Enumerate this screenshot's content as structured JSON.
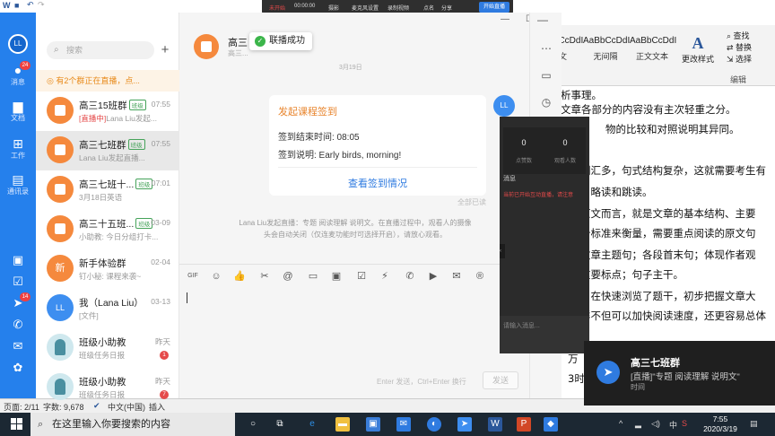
{
  "recorder_bar": {
    "items": [
      "未开始",
      "00:00:00",
      "摄影",
      "麦克风设置",
      "录制视频",
      "点名",
      "分享",
      "自定义选",
      "开始直播"
    ]
  },
  "word": {
    "styles": [
      {
        "sample": "AaBbCcDdI",
        "name": "正文"
      },
      {
        "sample": "AaBbCcDdI",
        "name": "无间隔"
      },
      {
        "sample": "AaBbCcDdI",
        "name": "正文文本"
      }
    ],
    "change_style": "更改样式",
    "edit_cmds": [
      "查找",
      "替换",
      "选择"
    ],
    "edit_label": "编辑",
    "doc_lines": [
      "析事理。",
      "文章各部分的内容没有主次轻重之分。",
      "物的比较和对照说明其异同。",
      "词汇多，句式结构复杂，这就需要考生有",
      "、略读和跳读。",
      "原文而言，就是文章的基本结构、主要",
      "个标准来衡量，需要重点阅读的原文句",
      "文章主题句；各段首末句；体现作者观",
      "重要标点；句子主干。",
      "。在快速浏览了题干，初步把握文章大",
      "样不但可以加快阅读速度，还更容易总体",
      "万",
      "3时间"
    ],
    "status": {
      "page": "页面: 2/11",
      "words": "字数: 9,678",
      "lang": "中文(中国)",
      "mode": "插入"
    }
  },
  "sidebar": {
    "avatar": "LL",
    "items": [
      {
        "label": "消息",
        "icon": "chat-icon",
        "badge": "24"
      },
      {
        "label": "文档",
        "icon": "folder-icon"
      },
      {
        "label": "工作",
        "icon": "apps-icon"
      },
      {
        "label": "通讯录",
        "icon": "contacts-icon"
      }
    ],
    "badge_14": "14"
  },
  "chatlist": {
    "search_placeholder": "搜索",
    "add": "+",
    "live_notice": "有2个群正在直播，点...",
    "conversations": [
      {
        "title": "高三15班群",
        "tag": "班级",
        "time": "07:55",
        "sub_red": "[直播中]",
        "sub": "Lana Liu发起...",
        "avatar": "orange"
      },
      {
        "title": "高三七班群",
        "tag": "班级",
        "time": "07:55",
        "sub_red": "",
        "sub": "Lana Liu发起直播...",
        "avatar": "orange"
      },
      {
        "title": "高三七班十...",
        "tag": "班级",
        "time": "07:01",
        "sub_red": "",
        "sub": "3月18日英语",
        "avatar": "orange"
      },
      {
        "title": "高三十五班...",
        "tag": "班级",
        "time": "03-09",
        "sub_red": "",
        "sub": "小助教: 今日分组打卡...",
        "avatar": "orange"
      },
      {
        "title": "新手体验群",
        "tag": "",
        "time": "02-04",
        "sub_red": "",
        "sub": "钉小秘: 课程来袭~",
        "avatar": "orange2",
        "avatar_text": "新"
      },
      {
        "title": "我（Lana Liu）",
        "tag": "",
        "time": "03-13",
        "sub_red": "",
        "sub": "[文件]",
        "avatar": "blue",
        "avatar_text": "LL"
      },
      {
        "title": "班级小助教",
        "tag": "",
        "time": "昨天",
        "sub_red": "",
        "sub": "班级任务日报",
        "avatar": "teal",
        "badge": "1"
      },
      {
        "title": "班级小助教",
        "tag": "",
        "time": "昨天",
        "sub_red": "",
        "sub": "班级任务日报",
        "avatar": "teal",
        "badge": "7"
      }
    ]
  },
  "chat": {
    "header_title": "高三",
    "header_sub": "高三...",
    "toast": "联播成功",
    "partial_label": "3月19日",
    "card": {
      "title": "发起课程签到",
      "end_time": "签到结束时间: 08:05",
      "note": "签到说明: Early birds, morning!",
      "link": "查看签到情况"
    },
    "me_avatar": "LL",
    "read_status": "全部已读",
    "system_note_1": "Lana Liu发起直播：专题 阅读理解 说明文。在直播过程中，观看人的摄像",
    "system_note_2": "头会自动关闭（仅连麦功能时可选择开启），请放心观看。",
    "send_hint": "Enter 发送，Ctrl+Enter 换行",
    "send_button": "发送"
  },
  "live_panel": {
    "stats": [
      {
        "value": "0",
        "label": "点赞数"
      },
      {
        "value": "0",
        "label": "观看人数"
      }
    ],
    "tab": "消息",
    "message": "当前已开始互动直播，请注意",
    "input_placeholder": "请输入消息..."
  },
  "notification": {
    "title": "高三七班群",
    "body": "[直播]\"专题 阅读理解 说明文\"",
    "body2": "时间"
  },
  "taskbar": {
    "search_placeholder": "在这里输入你要搜索的内容",
    "time": "7:55",
    "date": "2020/3/19"
  }
}
